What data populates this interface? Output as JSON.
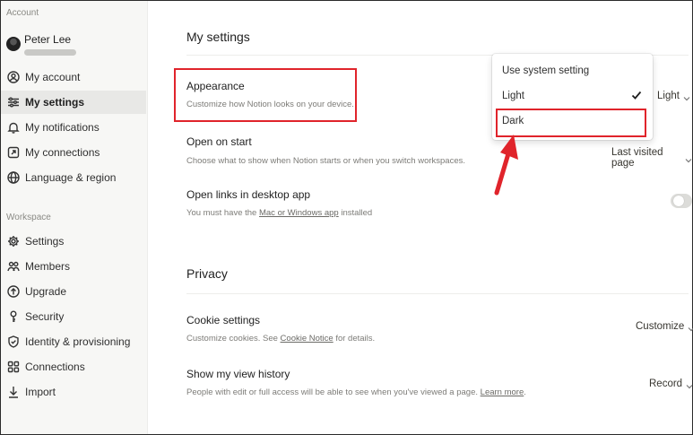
{
  "sidebar": {
    "account_label": "Account",
    "user_name": "Peter Lee",
    "account_items": [
      {
        "label": "My account",
        "icon": "user-circle-icon"
      },
      {
        "label": "My settings",
        "icon": "sliders-icon",
        "active": true
      },
      {
        "label": "My notifications",
        "icon": "bell-icon"
      },
      {
        "label": "My connections",
        "icon": "link-out-icon"
      },
      {
        "label": "Language & region",
        "icon": "globe-icon"
      }
    ],
    "workspace_label": "Workspace",
    "workspace_items": [
      {
        "label": "Settings",
        "icon": "gear-icon"
      },
      {
        "label": "Members",
        "icon": "people-icon"
      },
      {
        "label": "Upgrade",
        "icon": "arrow-up-circle-icon"
      },
      {
        "label": "Security",
        "icon": "key-icon"
      },
      {
        "label": "Identity & provisioning",
        "icon": "shield-icon"
      },
      {
        "label": "Connections",
        "icon": "grid-icon"
      },
      {
        "label": "Import",
        "icon": "download-icon"
      }
    ]
  },
  "main": {
    "title": "My settings",
    "appearance": {
      "title": "Appearance",
      "desc": "Customize how Notion looks on your device.",
      "value": "Light"
    },
    "open_on_start": {
      "title": "Open on start",
      "desc": "Choose what to show when Notion starts or when you switch workspaces.",
      "value": "Last visited page"
    },
    "open_links": {
      "title": "Open links in desktop app",
      "desc_prefix": "You must have the ",
      "desc_link": "Mac or Windows app",
      "desc_suffix": " installed",
      "toggle_on": false
    },
    "privacy_title": "Privacy",
    "cookie": {
      "title": "Cookie settings",
      "desc_prefix": "Customize cookies. See ",
      "desc_link": "Cookie Notice",
      "desc_suffix": " for details.",
      "value": "Customize"
    },
    "view_history": {
      "title": "Show my view history",
      "desc_prefix": "People with edit or full access will be able to see when you've viewed a page. ",
      "desc_link": "Learn more",
      "desc_suffix": ".",
      "value": "Record"
    }
  },
  "dropdown": {
    "options": [
      "Use system setting",
      "Light",
      "Dark"
    ],
    "selected": "Light"
  },
  "colors": {
    "highlight": "#e0242b",
    "sidebar_bg": "#f7f7f5"
  }
}
